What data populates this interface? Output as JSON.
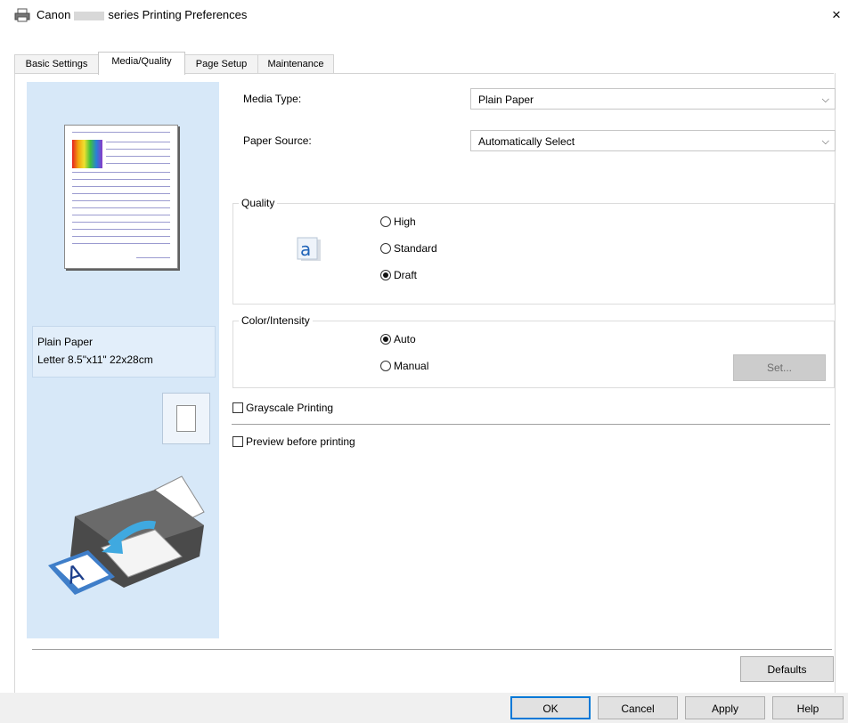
{
  "window": {
    "title_prefix": "Canon",
    "title_suffix": "series Printing Preferences"
  },
  "tabs": [
    {
      "label": "Basic Settings"
    },
    {
      "label": "Media/Quality"
    },
    {
      "label": "Page Setup"
    },
    {
      "label": "Maintenance"
    }
  ],
  "preview": {
    "media": "Plain Paper",
    "size": "Letter 8.5\"x11\" 22x28cm"
  },
  "media_type": {
    "label": "Media Type:",
    "value": "Plain Paper"
  },
  "paper_source": {
    "label": "Paper Source:",
    "value": "Automatically Select"
  },
  "quality": {
    "title": "Quality",
    "options": [
      {
        "label": "High",
        "selected": false
      },
      {
        "label": "Standard",
        "selected": false
      },
      {
        "label": "Draft",
        "selected": true
      }
    ],
    "icon": "quality-a-icon"
  },
  "color_intensity": {
    "title": "Color/Intensity",
    "options": [
      {
        "label": "Auto",
        "selected": true
      },
      {
        "label": "Manual",
        "selected": false
      }
    ],
    "set_label": "Set..."
  },
  "grayscale": {
    "label": "Grayscale Printing",
    "checked": false
  },
  "preview_before": {
    "label": "Preview before printing",
    "checked": false
  },
  "buttons": {
    "defaults": "Defaults",
    "ok": "OK",
    "cancel": "Cancel",
    "apply": "Apply",
    "help": "Help"
  },
  "icons": {
    "close": "×",
    "chevron": "⌵"
  },
  "colors": {
    "preview_bg": "#d7e8f8",
    "ok_border": "#0078d7"
  }
}
